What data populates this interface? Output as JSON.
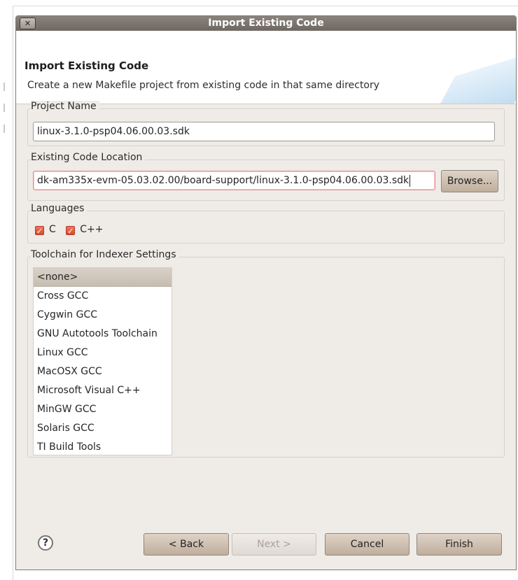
{
  "window": {
    "title": "Import Existing Code",
    "close_glyph": "✕",
    "close_icon": "close-icon"
  },
  "banner": {
    "title": "Import Existing Code",
    "description": "Create a new Makefile project from existing code in that same directory"
  },
  "project_name": {
    "label": "Project Name",
    "value": "linux-3.1.0-psp04.06.00.03.sdk"
  },
  "code_location": {
    "label": "Existing Code Location",
    "value": "dk-am335x-evm-05.03.02.00/board-support/linux-3.1.0-psp04.06.00.03.sdk",
    "browse_label": "Browse..."
  },
  "languages": {
    "label": "Languages",
    "items": [
      {
        "label": "C",
        "checked": true
      },
      {
        "label": "C++",
        "checked": true
      }
    ]
  },
  "toolchain": {
    "label": "Toolchain for Indexer Settings",
    "items": [
      {
        "label": "<none>",
        "selected": true
      },
      {
        "label": "Cross GCC"
      },
      {
        "label": "Cygwin GCC"
      },
      {
        "label": "GNU Autotools Toolchain"
      },
      {
        "label": "Linux GCC"
      },
      {
        "label": "MacOSX GCC"
      },
      {
        "label": "Microsoft Visual C++"
      },
      {
        "label": "MinGW GCC"
      },
      {
        "label": "Solaris GCC"
      },
      {
        "label": "TI Build Tools"
      }
    ]
  },
  "footer": {
    "help_glyph": "?",
    "help_icon": "help-icon",
    "back_label": "< Back",
    "next_label": "Next >",
    "cancel_label": "Cancel",
    "finish_label": "Finish",
    "next_enabled": false
  },
  "colors": {
    "dialog_background": "#efebe7",
    "title_bar": "#756f68",
    "checkbox_checked": "#e35b3c",
    "focused_input_border": "#e48d8d"
  }
}
